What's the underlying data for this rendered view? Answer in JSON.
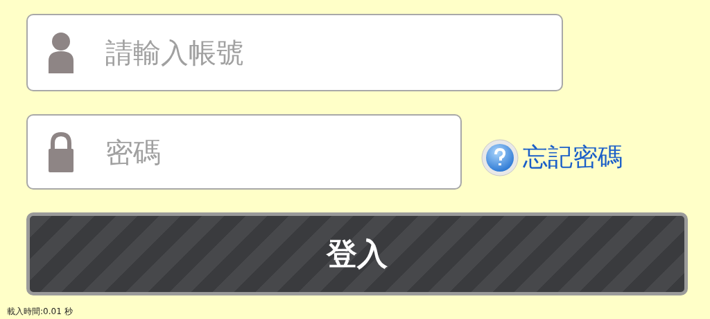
{
  "username": {
    "placeholder": "請輸入帳號"
  },
  "password": {
    "placeholder": "密碼"
  },
  "forgot_link": "忘記密碼",
  "login_button": "登入",
  "load_time": "載入時間:0.01 秒"
}
